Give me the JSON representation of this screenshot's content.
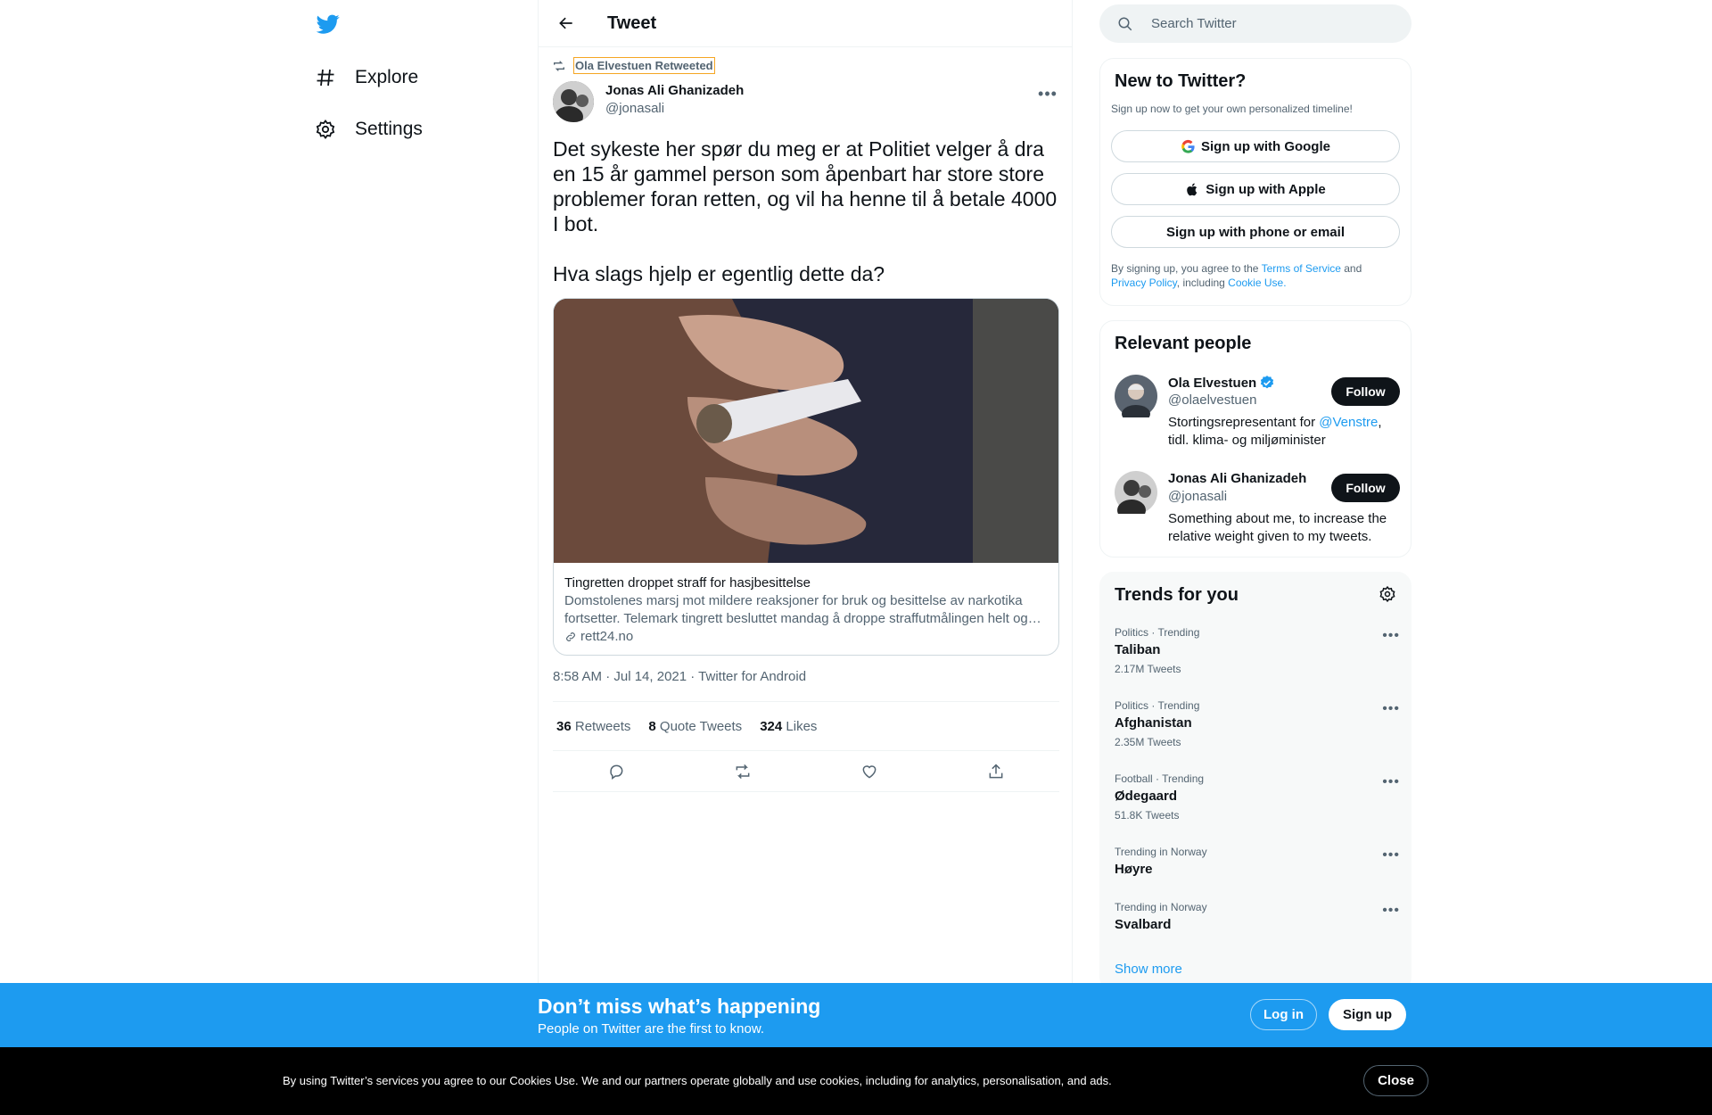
{
  "nav": {
    "items": [
      {
        "label": "Explore",
        "icon": "hashtag-icon"
      },
      {
        "label": "Settings",
        "icon": "gear-icon"
      }
    ]
  },
  "header": {
    "title": "Tweet"
  },
  "tweet": {
    "retweeted_by": "Ola Elvestuen Retweeted",
    "author_name": "Jonas Ali Ghanizadeh",
    "author_handle": "@jonasali",
    "text_p1": "Det sykeste her spør du meg er at Politiet velger å dra en 15 år gammel person som åpenbart har store store problemer foran retten, og vil ha henne til å betale 4000 I bot.",
    "text_p2": "Hva slags hjelp er egentlig dette da?",
    "card": {
      "title": "Tingretten droppet straff for hasjbesittelse",
      "description": "Domstolenes marsj mot mildere reaksjoner for bruk og besittelse av narkotika fortsetter. Telemark tingrett besluttet mandag å droppe straffutmålingen helt og…",
      "domain": "rett24.no"
    },
    "timestamp": "8:58 AM · Jul 14, 2021 · Twitter for Android",
    "stats": {
      "retweets_count": "36",
      "retweets_label": "Retweets",
      "quotes_count": "8",
      "quotes_label": "Quote Tweets",
      "likes_count": "324",
      "likes_label": "Likes"
    }
  },
  "search": {
    "placeholder": "Search Twitter"
  },
  "new_to_twitter": {
    "title": "New to Twitter?",
    "subtitle": "Sign up now to get your own personalized timeline!",
    "google": "Sign up with Google",
    "apple": "Sign up with Apple",
    "phone": "Sign up with phone or email",
    "legal_1": "By signing up, you agree to the ",
    "tos": "Terms of Service",
    "legal_2": " and ",
    "privacy": "Privacy Policy",
    "legal_3": ", including ",
    "cookie": "Cookie Use."
  },
  "relevant_people": {
    "title": "Relevant people",
    "people": [
      {
        "name": "Ola Elvestuen",
        "handle": "@olaelvestuen",
        "bio_pre": "Stortingsrepresentant for ",
        "bio_link": "@Venstre",
        "bio_post": ", tidl. klima- og miljøminister",
        "follow": "Follow"
      },
      {
        "name": "Jonas Ali Ghanizadeh",
        "handle": "@jonasali",
        "bio": "Something about me, to increase the relative weight given to my tweets.",
        "follow": "Follow"
      }
    ]
  },
  "trends": {
    "title": "Trends for you",
    "items": [
      {
        "meta": "Politics · Trending",
        "name": "Taliban",
        "count": "2.17M Tweets"
      },
      {
        "meta": "Politics · Trending",
        "name": "Afghanistan",
        "count": "2.35M Tweets"
      },
      {
        "meta": "Football · Trending",
        "name": "Ødegaard",
        "count": "51.8K Tweets"
      },
      {
        "meta": "Trending in Norway",
        "name": "Høyre",
        "count": ""
      },
      {
        "meta": "Trending in Norway",
        "name": "Svalbard",
        "count": ""
      }
    ],
    "show_more": "Show more"
  },
  "signup_bar": {
    "headline": "Don’t miss what’s happening",
    "sub": "People on Twitter are the first to know.",
    "login": "Log in",
    "signup": "Sign up"
  },
  "cookie_bar": {
    "text": "By using Twitter’s services you agree to our Cookies Use. We and our partners operate globally and use cookies, including for analytics, personalisation, and ads.",
    "close": "Close"
  },
  "colors": {
    "brand": "#1d9bf0",
    "text": "#0f1419",
    "muted": "#536471"
  }
}
